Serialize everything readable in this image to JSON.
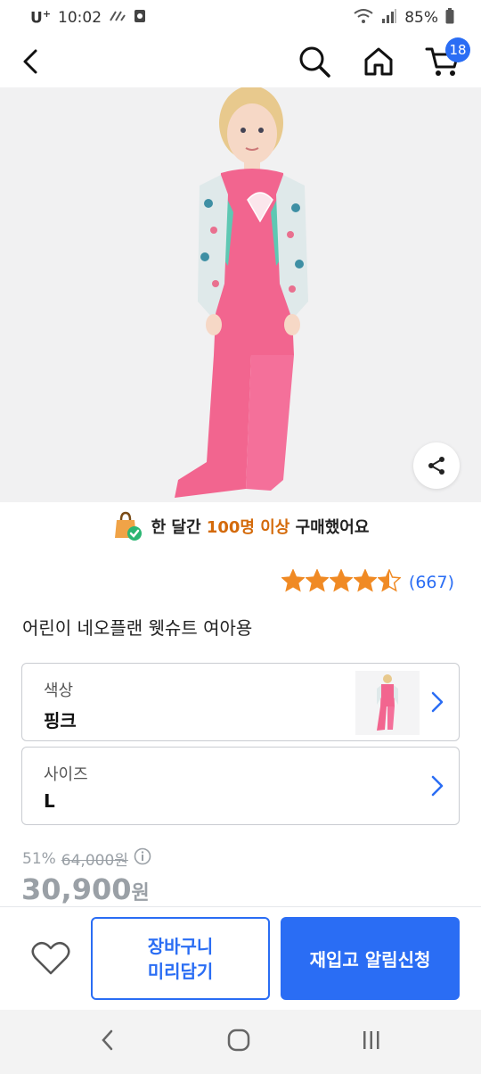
{
  "status_bar": {
    "carrier": "U",
    "carrier_sup": "+",
    "time": "10:02",
    "battery": "85%"
  },
  "header": {
    "cart_badge": "18",
    "icons": [
      "back-icon",
      "search-icon",
      "home-icon",
      "cart-icon"
    ]
  },
  "product": {
    "purchase_prefix": "한 달간 ",
    "purchase_highlight": "100명 이상",
    "purchase_suffix": " 구매했어요",
    "rating_value": 4.5,
    "rating_count": "(667)",
    "title": "어린이 네오플랜 웻슈트 여아용"
  },
  "options": {
    "color_label": "색상",
    "color_value": "핑크",
    "size_label": "사이즈",
    "size_value": "L"
  },
  "pricing": {
    "discount": "51%",
    "original": "64,000원",
    "price": "30,900",
    "currency": "원"
  },
  "actions": {
    "add_to_cart": "장바구니\n미리담기",
    "restock_alert": "재입고 알림신청"
  },
  "colors": {
    "accent": "#2a6df4",
    "highlight": "#d46a0a",
    "star": "#f08a24",
    "wetsuit_pink": "#f2658f"
  }
}
